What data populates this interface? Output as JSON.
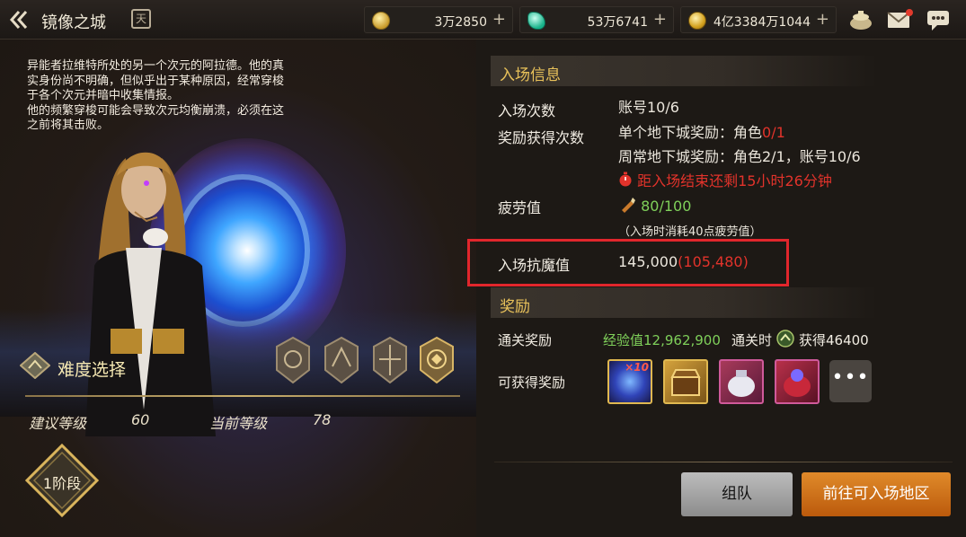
{
  "header": {
    "title": "镜像之城",
    "calendar_glyph": "天",
    "currencies": [
      {
        "icon": "gold-c-coin-icon",
        "amount": "3万2850"
      },
      {
        "icon": "green-gem-icon",
        "amount": "53万6741"
      },
      {
        "icon": "gold-coin-icon",
        "amount": "4亿3384万1044"
      }
    ]
  },
  "description": [
    "异能者拉维特所处的另一个次元的阿拉德。他的真",
    "实身份尚不明确，但似乎出于某种原因，经常穿梭",
    "于各个次元并暗中收集情报。",
    "他的频繁穿梭可能会导致次元均衡崩溃，必须在这",
    "之前将其击败。"
  ],
  "difficulty": {
    "label": "难度选择",
    "recommended_label": "建议等级",
    "recommended_value": "60",
    "current_label": "当前等级",
    "current_value": "78",
    "stage": "1阶段"
  },
  "entry_info": {
    "section_title": "入场信息",
    "entry_count_label": "入场次数",
    "entry_count_value": "账号10/6",
    "reward_count_label": "奖励获得次数",
    "single_reward_prefix": "单个地下城奖励：角色",
    "single_reward_value": "0/1",
    "weekly_reward": "周常地下城奖励：角色2/1，账号10/6",
    "timer_text": "距入场结束还剩15小时26分钟",
    "fatigue_label": "疲劳值",
    "fatigue_value": "80/100",
    "fatigue_note": "（入场时消耗40点疲劳值）",
    "resistance_label": "入场抗魔值",
    "resistance_value": "145,000",
    "resistance_current": "(105,480)"
  },
  "rewards": {
    "section_title": "奖励",
    "clear_label": "通关奖励",
    "exp_text": "经验值12,962,900",
    "clear_time_label": "通关时",
    "gain_text": "获得46400",
    "available_label": "可获得奖励",
    "item1_badge": "×10",
    "more_label": "•••"
  },
  "buttons": {
    "party": "组队",
    "go": "前往可入场地区"
  },
  "colors": {
    "accent_gold": "#e9c25a",
    "warning_red": "#e2332b",
    "positive_green": "#7fd05a",
    "go_button": "#d47419"
  }
}
